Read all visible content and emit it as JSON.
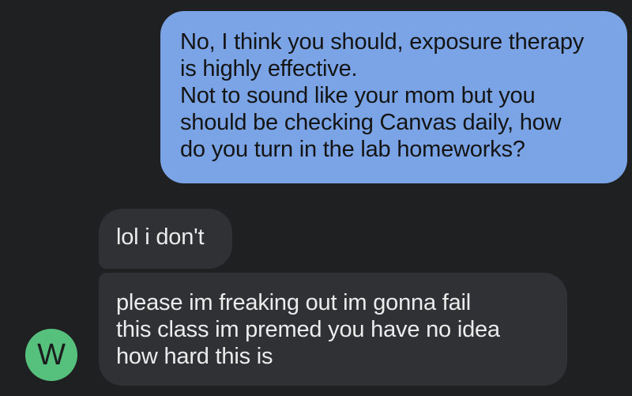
{
  "conversation": {
    "sent": [
      {
        "text": "No, I think you should, exposure therapy\nis highly effective.\nNot to sound like your mom but you\nshould be checking Canvas daily, how\ndo you turn in the lab homeworks?"
      }
    ],
    "received": [
      {
        "text": "lol i don't"
      },
      {
        "text": "please im freaking out im gonna fail\nthis class im premed you have no idea\nhow hard this is"
      }
    ],
    "contact": {
      "avatar_letter": "W",
      "avatar_color": "#56c17c"
    }
  },
  "colors": {
    "background": "#1f2022",
    "sent_bubble": "#7aa4e6",
    "received_bubble": "#303134"
  }
}
